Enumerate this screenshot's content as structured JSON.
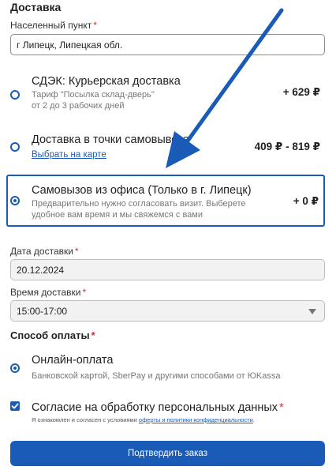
{
  "delivery": {
    "section_title": "Доставка",
    "city_label": "Населенный пункт",
    "city_value": "г Липецк, Липецкая обл.",
    "options": [
      {
        "title": "СДЭК: Курьерская доставка",
        "desc_line1": "Тариф \"Посылка склад-дверь\"",
        "desc_line2": "от 2 до 3 рабочих дней",
        "price": "+ 629 ₽",
        "selected": false
      },
      {
        "title": "Доставка в точки самовывоза",
        "link": "Выбрать на карте",
        "price": "409 ₽ - 819 ₽",
        "selected": false
      },
      {
        "title": "Самовызов из офиса (Только в г. Липецк)",
        "desc_line1": "Предварительно нужно согласовать визит. Выберете",
        "desc_line2": "удобное вам время и мы свяжемся с вами",
        "price": "+ 0 ₽",
        "selected": true
      }
    ]
  },
  "date": {
    "label": "Дата доставки",
    "value": "20.12.2024"
  },
  "time": {
    "label": "Время доставки",
    "value": "15:00-17:00"
  },
  "payment": {
    "title": "Способ оплаты",
    "option_title": "Онлайн-оплата",
    "option_desc": "Банковской картой, SberPay и другими способами от ЮKassa"
  },
  "consent": {
    "title": "Согласие на обработку персональных данных",
    "note_prefix": "Я ознакомлен и согласен с условиями ",
    "note_link": "оферты и политики конфиденциальности",
    "note_suffix": ".",
    "checked": true
  },
  "submit_label": "Подтвердить заказ",
  "required_mark": "*",
  "colors": {
    "accent": "#1a5bb8",
    "required": "#d32f2f"
  },
  "annotation": {
    "icon": "arrow-pointer-icon"
  }
}
